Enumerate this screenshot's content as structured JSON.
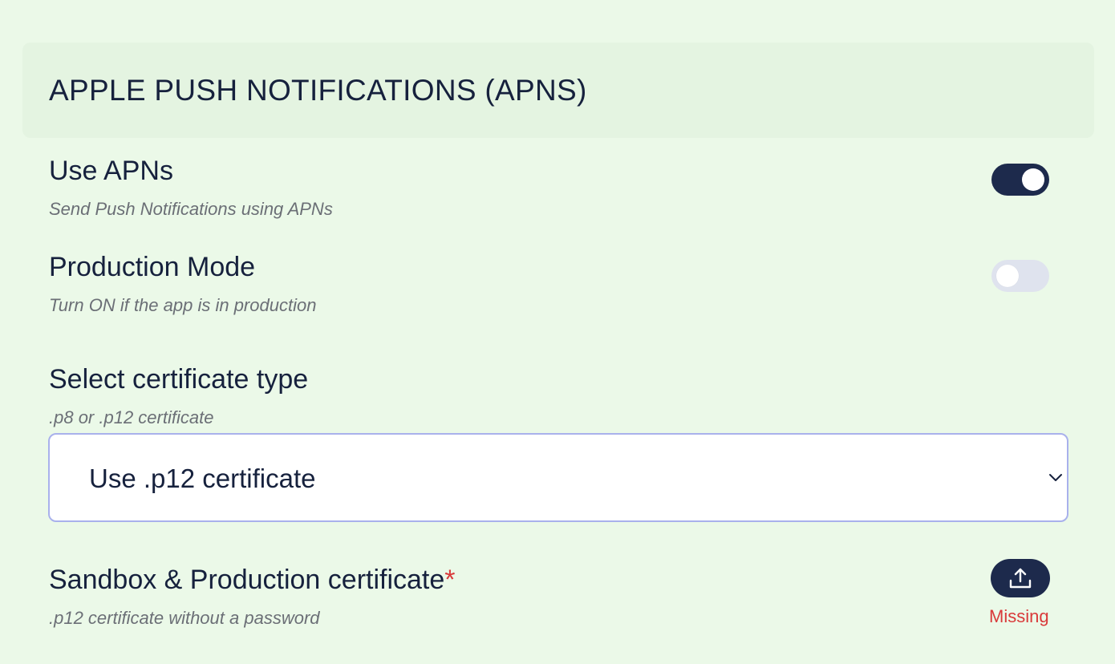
{
  "section": {
    "title": "APPLE PUSH NOTIFICATIONS (APNS)"
  },
  "use_apns": {
    "label": "Use APNs",
    "description": "Send Push Notifications using APNs",
    "enabled": true
  },
  "production_mode": {
    "label": "Production Mode",
    "description": "Turn ON if the app is in production",
    "enabled": false
  },
  "certificate_type": {
    "label": "Select certificate type",
    "description": ".p8 or .p12 certificate",
    "selected": "Use .p12 certificate",
    "icon": "chevron-down-icon"
  },
  "certificate_upload": {
    "label": "Sandbox & Production certificate",
    "required_mark": "*",
    "description": ".p12 certificate without a password",
    "status": "Missing",
    "icon": "upload-icon"
  },
  "colors": {
    "background": "#ebf9e8",
    "header_background": "#e4f4e1",
    "primary": "#1d2a4c",
    "toggle_off": "#dfe3ee",
    "select_border": "#a9b1ec",
    "error": "#d93a3a",
    "muted_text": "#6b6f76"
  }
}
